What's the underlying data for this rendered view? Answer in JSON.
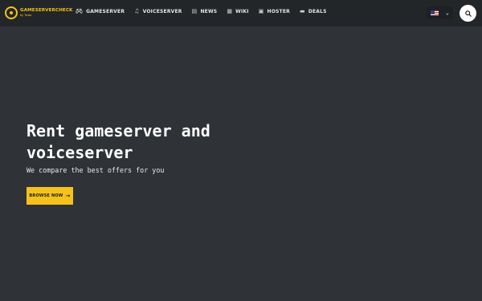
{
  "brand": {
    "name": "GAMESERVERCHECK",
    "sub": "by Tauto"
  },
  "nav": {
    "items": [
      {
        "label": "GAMESERVER",
        "icon": "gamepad-icon"
      },
      {
        "label": "VOICESERVER",
        "icon": "headset-icon"
      },
      {
        "label": "NEWS",
        "icon": "document-icon"
      },
      {
        "label": "WIKI",
        "icon": "book-icon"
      },
      {
        "label": "HOSTER",
        "icon": "lock-icon"
      },
      {
        "label": "DEALS",
        "icon": "ticket-icon"
      }
    ]
  },
  "language": {
    "icon": "us-flag-icon"
  },
  "hero": {
    "title": "Rent gameserver and voiceserver",
    "subtitle": "We compare the best offers for you",
    "cta_label": "BROWSE NOW"
  },
  "colors": {
    "accent": "#f5c21b",
    "background": "#2f3236",
    "topbar": "#232629"
  }
}
